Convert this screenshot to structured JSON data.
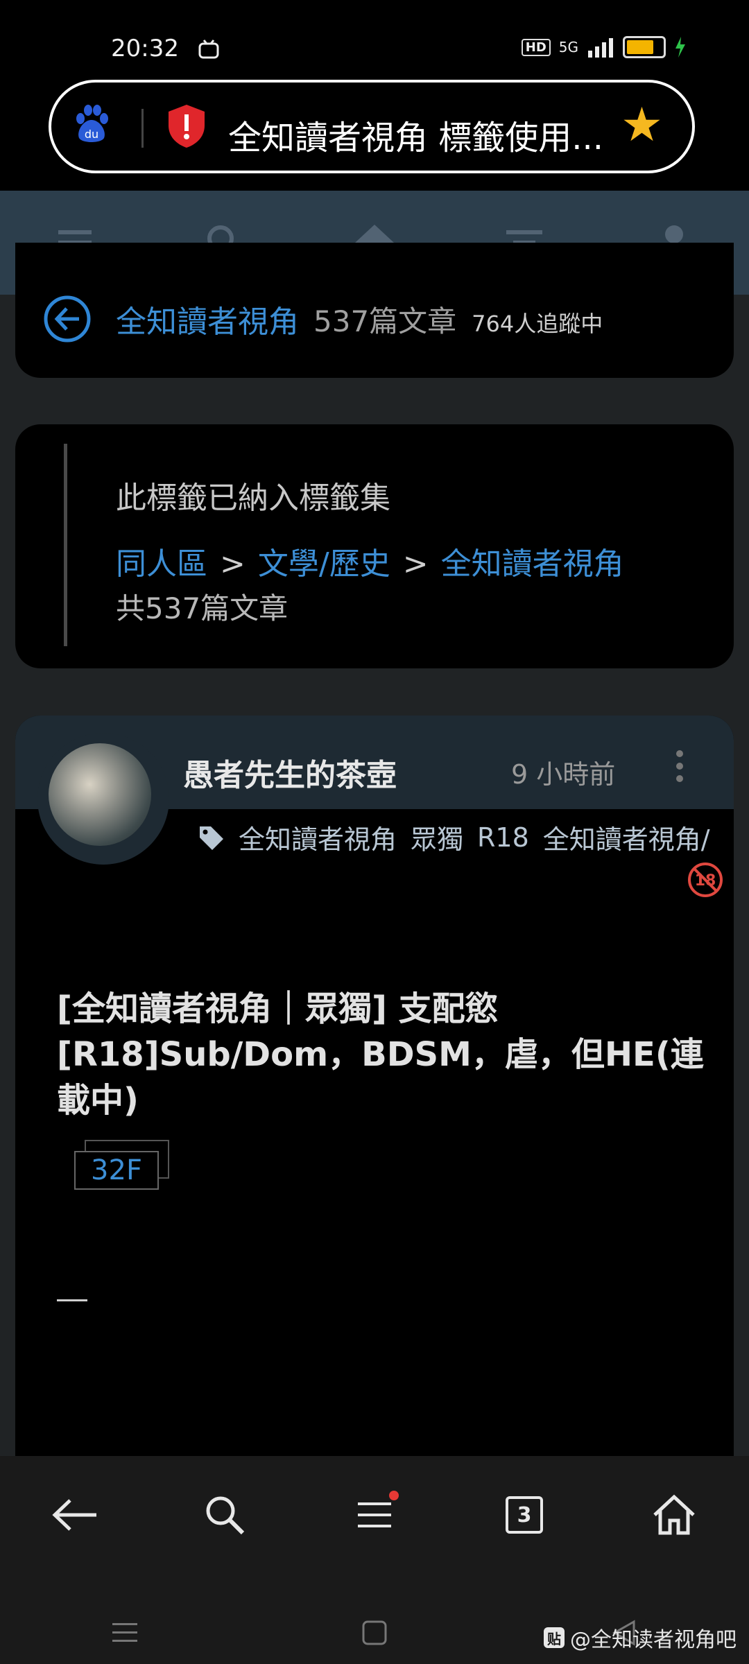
{
  "status_bar": {
    "time": "20:32",
    "hd": "HD",
    "network": "5G"
  },
  "browser": {
    "page_title": "全知讀者視角 標籤使用...",
    "tabs_count": "3"
  },
  "tag_header": {
    "name": "全知讀者視角",
    "articles": "537篇文章",
    "followers": "764人追蹤中"
  },
  "tagset": {
    "title": "此標籤已納入標籤集",
    "breadcrumb": [
      "同人區",
      "文學/歷史",
      "全知讀者視角"
    ],
    "separator": ">",
    "count": "共537篇文章"
  },
  "post": {
    "author": "愚者先生的茶壺",
    "time": "9 小時前",
    "tags": [
      "全知讀者視角",
      "眾獨",
      "R18",
      "全知讀者視角/"
    ],
    "title": "[全知讀者視角｜眾獨] 支配慾[R18]Sub/Dom，BDSM，虐，但HE(連載中)",
    "floor": "32F",
    "dash": "—"
  },
  "watermark": {
    "logo": "贴",
    "text": "@全知读者视角吧"
  },
  "colors": {
    "link": "#3d8fd6",
    "star": "#f5b820",
    "nav": "#2c3e4c"
  }
}
